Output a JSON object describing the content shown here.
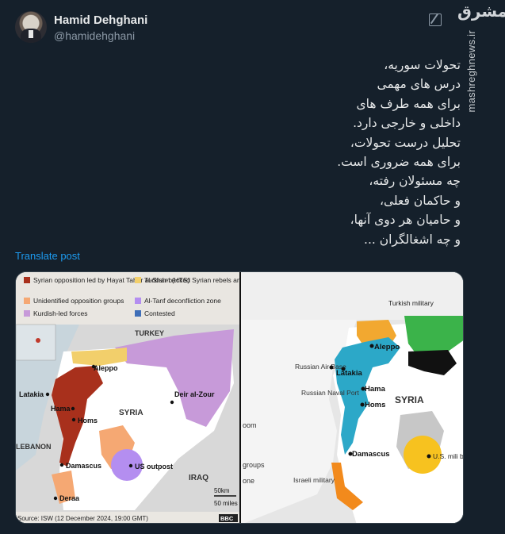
{
  "author": {
    "name": "Hamid Dehghani",
    "handle": "@hamidehghani"
  },
  "watermark": {
    "logo": "مشرق",
    "site": "mashreghnews.ir"
  },
  "tweet": {
    "lines": [
      "تحولات سوریه،",
      "درس های مهمی",
      "برای همه طرف های",
      "داخلی و خارجی دارد.",
      "تحلیل درست تحولات،",
      "برای همه ضروری است.",
      "چه مسئولان رفته،",
      "و حاکمان فعلی،",
      "و حامیان هر دوی آنها،",
      "و چه اشغالگران ..."
    ],
    "translate_label": "Translate post"
  },
  "left_map": {
    "legend": [
      {
        "label": "Syrian opposition led by Hayat Tahrir al-Sham (HTS)",
        "color": "#a8301c"
      },
      {
        "label": "Turkish-backed Syrian rebels and Turkish military",
        "color": "#f2cf6b"
      },
      {
        "label": "Unidentified opposition groups",
        "color": "#f5a873"
      },
      {
        "label": "Al-Tanf deconfliction zone",
        "color": "#b48ef0"
      },
      {
        "label": "Kurdish-led forces",
        "color": "#c79ad9"
      },
      {
        "label": "Contested",
        "color": "#3f6fb8"
      }
    ],
    "labels": {
      "turkey": "TURKEY",
      "aleppo": "Aleppo",
      "latakia": "Latakia",
      "hama": "Hama",
      "homs": "Homs",
      "syria": "SYRIA",
      "deir": "Deir al-Zour",
      "lebanon": "LEBANON",
      "damascus": "Damascus",
      "us_outpost": "US outpost",
      "iraq": "IRAQ",
      "deraa": "Deraa",
      "scale_km": "50km",
      "scale_mi": "50 miles",
      "source": "Source: ISW (12 December 2024, 19:00 GMT)",
      "bbc": "BBC"
    }
  },
  "right_map": {
    "labels": {
      "turkish_military": "Turkish military",
      "aleppo": "Aleppo",
      "russian_air": "Russian Air Base",
      "latakia": "Latakia",
      "hama": "Hama",
      "syria": "SYRIA",
      "russian_naval": "Russian Naval Port",
      "homs": "Homs",
      "damascus": "Damascus",
      "us_base": "U.S. mili base",
      "israeli_military": "Israeli military",
      "groups": "groups",
      "zoom": "oom",
      "zone": "one"
    }
  },
  "colors": {
    "background": "#15202b",
    "text": "#e7e9ea",
    "muted": "#8b98a5",
    "link": "#1d9bf0"
  }
}
